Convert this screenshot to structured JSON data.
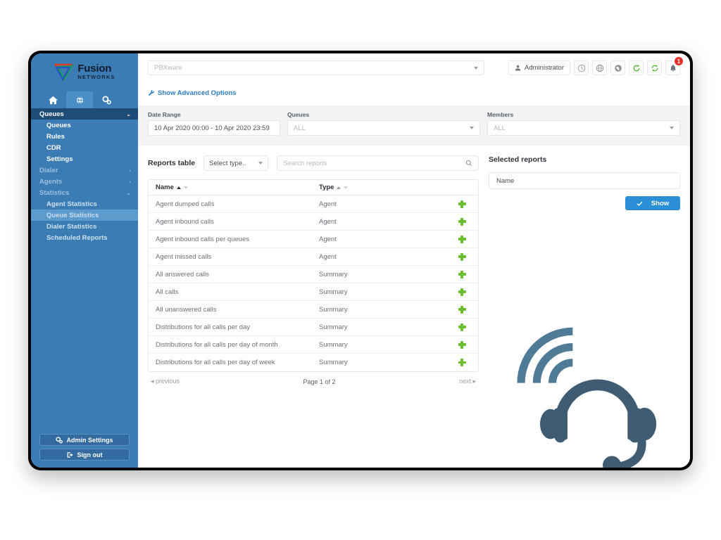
{
  "brand": {
    "name": "Fusion",
    "sub": "NETWORKS"
  },
  "nav_tabs": [
    {
      "name": "home-tab",
      "icon": "home-icon",
      "active": false
    },
    {
      "name": "contact-center-tab",
      "icon": "headset-globe-icon",
      "active": true
    },
    {
      "name": "settings-tab",
      "icon": "gears-icon",
      "active": false
    }
  ],
  "sidebar": {
    "groups": [
      {
        "label": "Queues",
        "state": "expanded",
        "style": "dark",
        "items": [
          "Queues",
          "Rules",
          "CDR",
          "Settings"
        ]
      },
      {
        "label": "Dialer",
        "state": "collapsed",
        "style": "muted",
        "items": []
      },
      {
        "label": "Agents",
        "state": "collapsed",
        "style": "muted",
        "items": []
      },
      {
        "label": "Statistics",
        "state": "expanded",
        "style": "muted",
        "items": [
          "Agent Statistics",
          "Queue Statistics",
          "Dialer Statistics",
          "Scheduled Reports"
        ]
      }
    ],
    "active_item": "Queue Statistics",
    "admin_settings_label": "Admin Settings",
    "sign_out_label": "Sign out"
  },
  "topbar": {
    "pbx_placeholder": "PBXware",
    "admin_label": "Administrator",
    "icons": [
      "clock-icon",
      "globe-icon",
      "globe-filled-icon",
      "refresh-icon",
      "sync-icon",
      "bell-icon"
    ],
    "bell_badge": "1",
    "advanced_options_label": "Show Advanced Options"
  },
  "filters": {
    "date_range": {
      "label": "Date Range",
      "value": "10 Apr 2020 00:00 - 10 Apr 2020 23:59"
    },
    "queues": {
      "label": "Queues",
      "value": "ALL"
    },
    "members": {
      "label": "Members",
      "value": "ALL"
    }
  },
  "reports": {
    "title": "Reports table",
    "select_type": "Select type..",
    "search_placeholder": "Search reports",
    "columns": [
      "Name",
      "Type"
    ],
    "sort": {
      "column": "Name",
      "direction": "asc"
    },
    "rows": [
      {
        "name": "Agent dumped calls",
        "type": "Agent"
      },
      {
        "name": "Agent inbound calls",
        "type": "Agent"
      },
      {
        "name": "Agent inbound calls per queues",
        "type": "Agent"
      },
      {
        "name": "Agent missed calls",
        "type": "Agent"
      },
      {
        "name": "All answered calls",
        "type": "Summary"
      },
      {
        "name": "All calls",
        "type": "Summary"
      },
      {
        "name": "All unanswered calls",
        "type": "Summary"
      },
      {
        "name": "Distributions for all calls per day",
        "type": "Summary"
      },
      {
        "name": "Distributions for all calls per day of month",
        "type": "Summary"
      },
      {
        "name": "Distributions for all calls per day of week",
        "type": "Summary"
      }
    ],
    "pagination": {
      "previous": "previous",
      "page_info": "Page 1 of 2",
      "next": "next"
    }
  },
  "selected": {
    "title": "Selected reports",
    "column_header": "Name",
    "show_label": "Show"
  },
  "colors": {
    "sidebar": "#3b7cb5",
    "sidebar_dark": "#1f4b77",
    "accent_blue": "#2b8fd6",
    "link_blue": "#2b7cc4",
    "plus_green": "#6abf2f",
    "badge_red": "#e8302b"
  }
}
